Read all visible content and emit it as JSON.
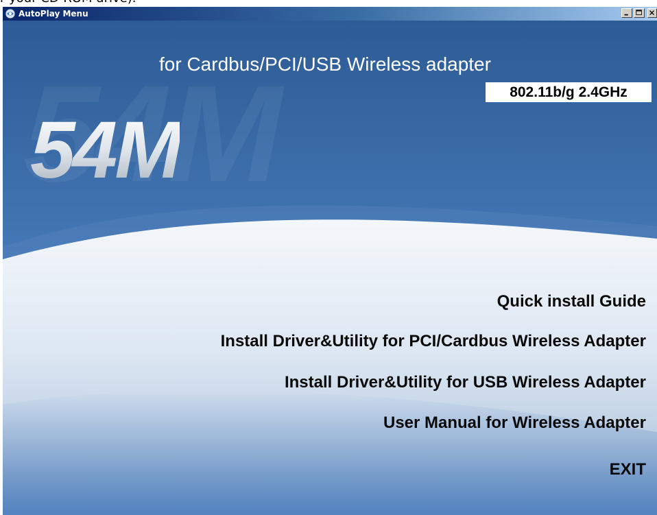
{
  "backdrop": {
    "cropped_text": "r your CD-ROM drive)."
  },
  "window": {
    "title": "AutoPlay Menu",
    "buttons": {
      "minimize": "minimize",
      "maximize": "maximize",
      "close": "close"
    }
  },
  "header": {
    "subtitle": "for Cardbus/PCI/USB Wireless adapter",
    "badge": "802.11b/g  2.4GHz",
    "logo": "54M"
  },
  "menu": {
    "items": [
      {
        "label": "Quick install Guide"
      },
      {
        "label": "Install Driver&Utility for PCI/Cardbus Wireless Adapter"
      },
      {
        "label": "Install Driver&Utility for USB Wireless Adapter"
      },
      {
        "label": "User Manual for Wireless Adapter"
      },
      {
        "label": "EXIT"
      }
    ]
  },
  "colors": {
    "background_blue": "#3d70ad",
    "wave_light": "#e7eef6",
    "titlebar_start": "#0a246a",
    "menu_text": "#0a0a0a"
  }
}
